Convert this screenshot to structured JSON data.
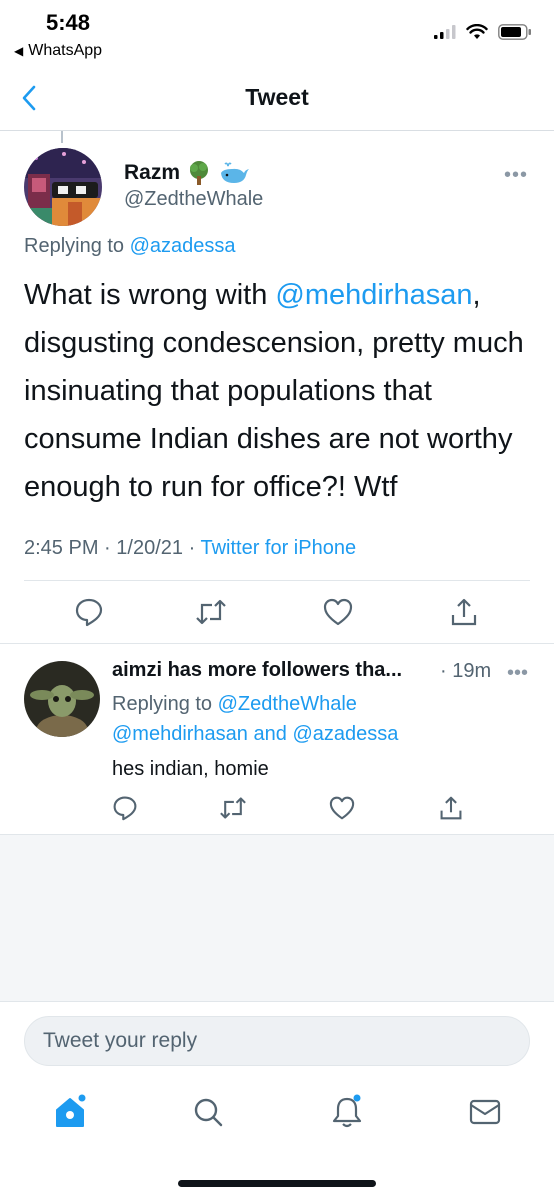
{
  "status_bar": {
    "time": "5:48",
    "back_app": "WhatsApp"
  },
  "header": {
    "title": "Tweet"
  },
  "tweet": {
    "author_name": "Razm",
    "author_handle": "@ZedtheWhale",
    "name_emojis": [
      "tree-icon",
      "whale-icon"
    ],
    "replying_prefix": "Replying to",
    "replying_to": "@azadessa",
    "text_before": "What is wrong with ",
    "mention": "@mehdirhasan",
    "text_after": ", disgusting condescension, pretty much insinuating that populations that consume Indian dishes are not worthy enough to run for office?! Wtf",
    "time": "2:45 PM",
    "date": "1/20/21",
    "separator": "·",
    "source": "Twitter for iPhone"
  },
  "reply": {
    "author_name": "aimzi has more followers tha...",
    "time": "· 19m",
    "replying_prefix": "Replying to",
    "replying_to_1": "@ZedtheWhale",
    "replying_to_2": "@mehdirhasan",
    "and_text": "and",
    "replying_to_3": "@azadessa",
    "text": "hes indian, homie"
  },
  "composer": {
    "placeholder": "Tweet your reply"
  },
  "tabbar": {
    "items": [
      "home-icon",
      "search-icon",
      "notifications-icon",
      "messages-icon"
    ]
  },
  "colors": {
    "accent": "#1d9bf0",
    "secondary_text": "#536471",
    "background_empty": "#f4f6f8"
  }
}
